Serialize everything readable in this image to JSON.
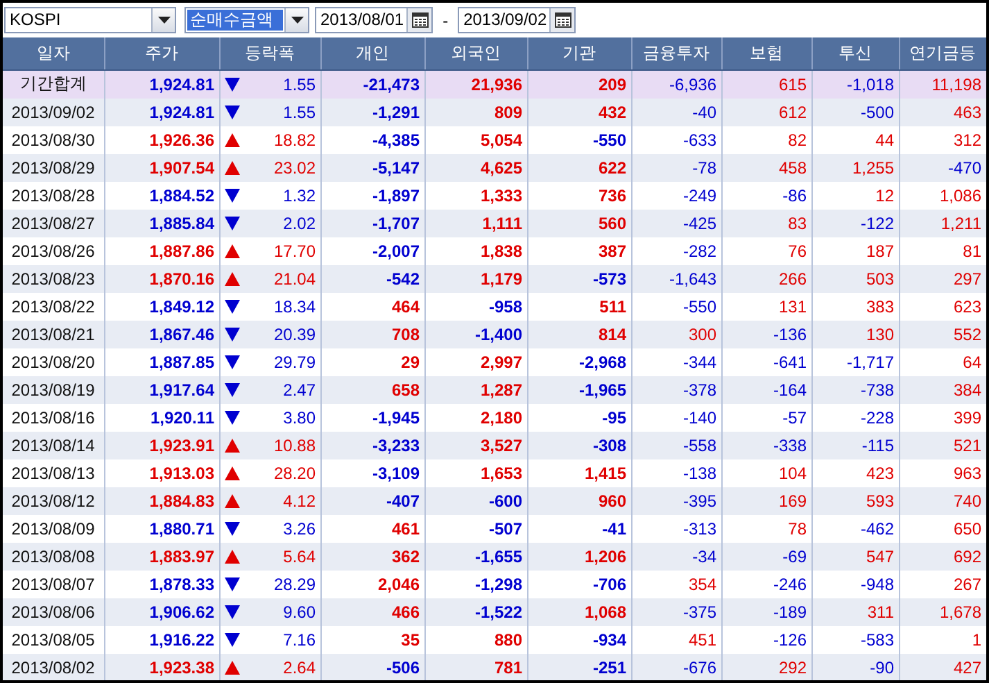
{
  "toolbar": {
    "market": {
      "value": "KOSPI"
    },
    "measure": {
      "value": "순매수금액"
    },
    "start_date": "2013/08/01",
    "separator": "-",
    "end_date": "2013/09/02"
  },
  "table": {
    "columns": [
      "일자",
      "주가",
      "등락폭",
      "개인",
      "외국인",
      "기관",
      "금융투자",
      "보험",
      "투신",
      "연기금등"
    ],
    "rows": [
      {
        "kind": "summary",
        "date": "기간합계",
        "price": "1,924.81",
        "rising": false,
        "change": "1.55",
        "values": [
          "-21,473",
          "21,936",
          "209",
          "-6,936",
          "615",
          "-1,018",
          "11,198"
        ]
      },
      {
        "kind": "day",
        "date": "2013/09/02",
        "price": "1,924.81",
        "rising": false,
        "change": "1.55",
        "values": [
          "-1,291",
          "809",
          "432",
          "-40",
          "612",
          "-500",
          "463"
        ]
      },
      {
        "kind": "day",
        "date": "2013/08/30",
        "price": "1,926.36",
        "rising": true,
        "change": "18.82",
        "values": [
          "-4,385",
          "5,054",
          "-550",
          "-633",
          "82",
          "44",
          "312"
        ]
      },
      {
        "kind": "day",
        "date": "2013/08/29",
        "price": "1,907.54",
        "rising": true,
        "change": "23.02",
        "values": [
          "-5,147",
          "4,625",
          "622",
          "-78",
          "458",
          "1,255",
          "-470"
        ]
      },
      {
        "kind": "day",
        "date": "2013/08/28",
        "price": "1,884.52",
        "rising": false,
        "change": "1.32",
        "values": [
          "-1,897",
          "1,333",
          "736",
          "-249",
          "-86",
          "12",
          "1,086"
        ]
      },
      {
        "kind": "day",
        "date": "2013/08/27",
        "price": "1,885.84",
        "rising": false,
        "change": "2.02",
        "values": [
          "-1,707",
          "1,111",
          "560",
          "-425",
          "83",
          "-122",
          "1,211"
        ]
      },
      {
        "kind": "day",
        "date": "2013/08/26",
        "price": "1,887.86",
        "rising": true,
        "change": "17.70",
        "values": [
          "-2,007",
          "1,838",
          "387",
          "-282",
          "76",
          "187",
          "81"
        ]
      },
      {
        "kind": "day",
        "date": "2013/08/23",
        "price": "1,870.16",
        "rising": true,
        "change": "21.04",
        "values": [
          "-542",
          "1,179",
          "-573",
          "-1,643",
          "266",
          "503",
          "297"
        ]
      },
      {
        "kind": "day",
        "date": "2013/08/22",
        "price": "1,849.12",
        "rising": false,
        "change": "18.34",
        "values": [
          "464",
          "-958",
          "511",
          "-550",
          "131",
          "383",
          "623"
        ]
      },
      {
        "kind": "day",
        "date": "2013/08/21",
        "price": "1,867.46",
        "rising": false,
        "change": "20.39",
        "values": [
          "708",
          "-1,400",
          "814",
          "300",
          "-136",
          "130",
          "552"
        ]
      },
      {
        "kind": "day",
        "date": "2013/08/20",
        "price": "1,887.85",
        "rising": false,
        "change": "29.79",
        "values": [
          "29",
          "2,997",
          "-2,968",
          "-344",
          "-641",
          "-1,717",
          "64"
        ]
      },
      {
        "kind": "day",
        "date": "2013/08/19",
        "price": "1,917.64",
        "rising": false,
        "change": "2.47",
        "values": [
          "658",
          "1,287",
          "-1,965",
          "-378",
          "-164",
          "-738",
          "384"
        ]
      },
      {
        "kind": "day",
        "date": "2013/08/16",
        "price": "1,920.11",
        "rising": false,
        "change": "3.80",
        "values": [
          "-1,945",
          "2,180",
          "-95",
          "-140",
          "-57",
          "-228",
          "399"
        ]
      },
      {
        "kind": "day",
        "date": "2013/08/14",
        "price": "1,923.91",
        "rising": true,
        "change": "10.88",
        "values": [
          "-3,233",
          "3,527",
          "-308",
          "-558",
          "-338",
          "-115",
          "521"
        ]
      },
      {
        "kind": "day",
        "date": "2013/08/13",
        "price": "1,913.03",
        "rising": true,
        "change": "28.20",
        "values": [
          "-3,109",
          "1,653",
          "1,415",
          "-138",
          "104",
          "423",
          "963"
        ]
      },
      {
        "kind": "day",
        "date": "2013/08/12",
        "price": "1,884.83",
        "rising": true,
        "change": "4.12",
        "values": [
          "-407",
          "-600",
          "960",
          "-395",
          "169",
          "593",
          "740"
        ]
      },
      {
        "kind": "day",
        "date": "2013/08/09",
        "price": "1,880.71",
        "rising": false,
        "change": "3.26",
        "values": [
          "461",
          "-507",
          "-41",
          "-313",
          "78",
          "-462",
          "650"
        ]
      },
      {
        "kind": "day",
        "date": "2013/08/08",
        "price": "1,883.97",
        "rising": true,
        "change": "5.64",
        "values": [
          "362",
          "-1,655",
          "1,206",
          "-34",
          "-69",
          "547",
          "692"
        ]
      },
      {
        "kind": "day",
        "date": "2013/08/07",
        "price": "1,878.33",
        "rising": false,
        "change": "28.29",
        "values": [
          "2,046",
          "-1,298",
          "-706",
          "354",
          "-246",
          "-948",
          "267"
        ]
      },
      {
        "kind": "day",
        "date": "2013/08/06",
        "price": "1,906.62",
        "rising": false,
        "change": "9.60",
        "values": [
          "466",
          "-1,522",
          "1,068",
          "-375",
          "-189",
          "311",
          "1,678"
        ]
      },
      {
        "kind": "day",
        "date": "2013/08/05",
        "price": "1,916.22",
        "rising": false,
        "change": "7.16",
        "values": [
          "35",
          "880",
          "-934",
          "451",
          "-126",
          "-583",
          "1"
        ]
      },
      {
        "kind": "day",
        "date": "2013/08/02",
        "price": "1,923.38",
        "rising": true,
        "change": "2.64",
        "values": [
          "-506",
          "781",
          "-251",
          "-676",
          "292",
          "-90",
          "427"
        ]
      }
    ]
  }
}
